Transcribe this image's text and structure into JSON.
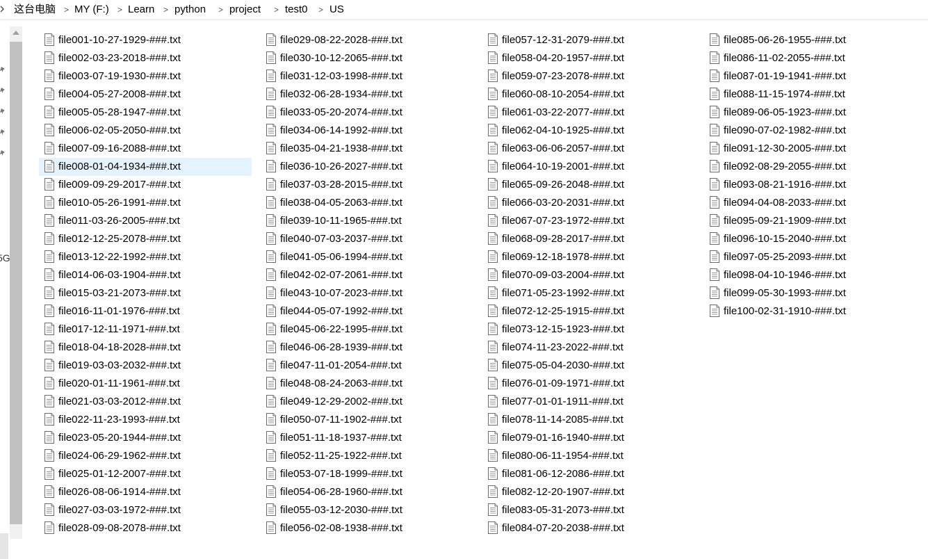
{
  "breadcrumb": {
    "items": [
      "这台电脑",
      "MY (F:)",
      "Learn",
      "python",
      "project",
      "test0",
      "US"
    ],
    "separator": ">"
  },
  "nav": {
    "partial_text": "5G"
  },
  "selected_file": "file008-01-04-1934-###.txt",
  "files": [
    [
      "file001-10-27-1929-###.txt",
      "file002-03-23-2018-###.txt",
      "file003-07-19-1930-###.txt",
      "file004-05-27-2008-###.txt",
      "file005-05-28-1947-###.txt",
      "file006-02-05-2050-###.txt",
      "file007-09-16-2088-###.txt",
      "file008-01-04-1934-###.txt",
      "file009-09-29-2017-###.txt",
      "file010-05-26-1991-###.txt",
      "file011-03-26-2005-###.txt",
      "file012-12-25-2078-###.txt",
      "file013-12-22-1992-###.txt",
      "file014-06-03-1904-###.txt",
      "file015-03-21-2073-###.txt",
      "file016-11-01-1976-###.txt",
      "file017-12-11-1971-###.txt",
      "file018-04-18-2028-###.txt",
      "file019-03-03-2032-###.txt",
      "file020-01-11-1961-###.txt",
      "file021-03-03-2012-###.txt",
      "file022-11-23-1993-###.txt",
      "file023-05-20-1944-###.txt",
      "file024-06-29-1962-###.txt",
      "file025-01-12-2007-###.txt",
      "file026-08-06-1914-###.txt",
      "file027-03-03-1972-###.txt",
      "file028-09-08-2078-###.txt"
    ],
    [
      "file029-08-22-2028-###.txt",
      "file030-10-12-2065-###.txt",
      "file031-12-03-1998-###.txt",
      "file032-06-28-1934-###.txt",
      "file033-05-20-2074-###.txt",
      "file034-06-14-1992-###.txt",
      "file035-04-21-1938-###.txt",
      "file036-10-26-2027-###.txt",
      "file037-03-28-2015-###.txt",
      "file038-04-05-2063-###.txt",
      "file039-10-11-1965-###.txt",
      "file040-07-03-2037-###.txt",
      "file041-05-06-1994-###.txt",
      "file042-02-07-2061-###.txt",
      "file043-10-07-2023-###.txt",
      "file044-05-07-1992-###.txt",
      "file045-06-22-1995-###.txt",
      "file046-06-28-1939-###.txt",
      "file047-11-01-2054-###.txt",
      "file048-08-24-2063-###.txt",
      "file049-12-29-2002-###.txt",
      "file050-07-11-1902-###.txt",
      "file051-11-18-1937-###.txt",
      "file052-11-25-1922-###.txt",
      "file053-07-18-1999-###.txt",
      "file054-06-28-1960-###.txt",
      "file055-03-12-2030-###.txt",
      "file056-02-08-1938-###.txt"
    ],
    [
      "file057-12-31-2079-###.txt",
      "file058-04-20-1957-###.txt",
      "file059-07-23-2078-###.txt",
      "file060-08-10-2054-###.txt",
      "file061-03-22-2077-###.txt",
      "file062-04-10-1925-###.txt",
      "file063-06-06-2057-###.txt",
      "file064-10-19-2001-###.txt",
      "file065-09-26-2048-###.txt",
      "file066-03-20-2031-###.txt",
      "file067-07-23-1972-###.txt",
      "file068-09-28-2017-###.txt",
      "file069-12-18-1978-###.txt",
      "file070-09-03-2004-###.txt",
      "file071-05-23-1992-###.txt",
      "file072-12-25-1915-###.txt",
      "file073-12-15-1923-###.txt",
      "file074-11-23-2022-###.txt",
      "file075-05-04-2030-###.txt",
      "file076-01-09-1971-###.txt",
      "file077-01-01-1911-###.txt",
      "file078-11-14-2085-###.txt",
      "file079-01-16-1940-###.txt",
      "file080-06-11-1954-###.txt",
      "file081-06-12-2086-###.txt",
      "file082-12-20-1907-###.txt",
      "file083-05-31-2073-###.txt",
      "file084-07-20-2038-###.txt"
    ],
    [
      "file085-06-26-1955-###.txt",
      "file086-11-02-2055-###.txt",
      "file087-01-19-1941-###.txt",
      "file088-11-15-1974-###.txt",
      "file089-06-05-1923-###.txt",
      "file090-07-02-1982-###.txt",
      "file091-12-30-2005-###.txt",
      "file092-08-29-2055-###.txt",
      "file093-08-21-1916-###.txt",
      "file094-04-08-2033-###.txt",
      "file095-09-21-1909-###.txt",
      "file096-10-15-2040-###.txt",
      "file097-05-25-2093-###.txt",
      "file098-04-10-1946-###.txt",
      "file099-05-30-1993-###.txt",
      "file100-02-31-1910-###.txt"
    ]
  ],
  "icons": {
    "file": "text-file-icon",
    "pin": "pin-icon",
    "separator": "chevron-right-icon"
  }
}
